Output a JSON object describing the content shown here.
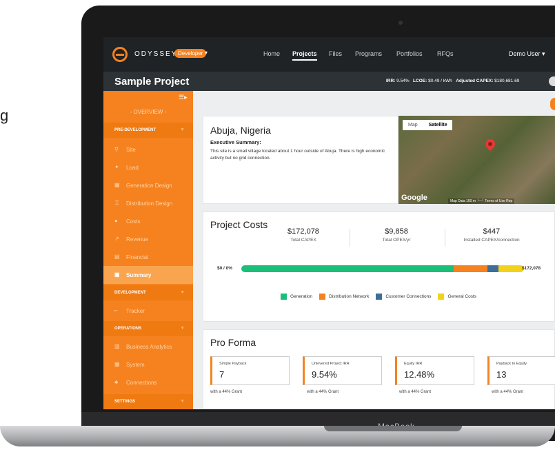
{
  "side_text": "g",
  "laptop_brand": "MacBook",
  "nav": {
    "logo_text": "ODYSSEY",
    "badge": "Developer",
    "items": [
      "Home",
      "Projects",
      "Files",
      "Programs",
      "Portfolios",
      "RFQs"
    ],
    "active": "Projects",
    "user": "Demo User ▾"
  },
  "project": {
    "title": "Sample Project",
    "irr_label": "IRR:",
    "irr": "9.54%",
    "lcoe_label": "LCOE:",
    "lcoe": "$0.49 / kWh",
    "capex_label": "Adjusted CAPEX:",
    "capex": "$180,681.69"
  },
  "sidebar": {
    "overview": "- OVERVIEW -",
    "sections": [
      {
        "label": "PRE-DEVELOPMENT",
        "items": [
          {
            "label": "Site",
            "icon": "pin-icon"
          },
          {
            "label": "Load",
            "icon": "plug-icon"
          },
          {
            "label": "Generation Design",
            "icon": "solar-panel-icon"
          },
          {
            "label": "Distribution Design",
            "icon": "tower-icon"
          },
          {
            "label": "Costs",
            "icon": "dollar-icon"
          },
          {
            "label": "Revenue",
            "icon": "chart-up-icon"
          },
          {
            "label": "Financial",
            "icon": "calculator-icon"
          },
          {
            "label": "Summary",
            "icon": "clipboard-icon"
          }
        ]
      },
      {
        "label": "DEVELOPMENT",
        "items": [
          {
            "label": "Tracker",
            "icon": "tracker-icon"
          }
        ]
      },
      {
        "label": "OPERATIONS",
        "items": [
          {
            "label": "Business Analytics",
            "icon": "bar-chart-icon"
          },
          {
            "label": "System",
            "icon": "grid-icon"
          },
          {
            "label": "Connections",
            "icon": "network-icon"
          }
        ]
      },
      {
        "label": "SETTINGS",
        "items": []
      }
    ],
    "active": "Summary"
  },
  "location": {
    "title": "Abuja, Nigeria",
    "exec_heading": "Executive Summary:",
    "exec_text": "This site is a small village located about 1 hour outside of Abuja. There is high economic activity but no grid connection."
  },
  "map": {
    "tab_map": "Map",
    "tab_satellite": "Satellite",
    "logo": "Google",
    "info": "Map Data  100 m └─┘  Terms of Use  Rep"
  },
  "costs": {
    "title": "Project Costs",
    "stats": [
      {
        "value": "$172,078",
        "label": "Total CAPEX"
      },
      {
        "value": "$9,858",
        "label": "Total OPEX/yr"
      },
      {
        "value": "$447",
        "label": "Installed CAPEX/connection"
      }
    ],
    "bar_left": "$0 / 0%",
    "bar_right": "$172,078",
    "segments": [
      {
        "name": "Generation",
        "share": 0.75,
        "color": "#1bbf7a"
      },
      {
        "name": "Distribution Network",
        "share": 0.12,
        "color": "#f5821f"
      },
      {
        "name": "Customer Connections",
        "share": 0.04,
        "color": "#3d6e9a"
      },
      {
        "name": "General Costs",
        "share": 0.09,
        "color": "#f2d21b"
      }
    ]
  },
  "proforma": {
    "title": "Pro Forma",
    "cards": [
      {
        "label": "Simple Payback",
        "value": "7",
        "sub": "with a 44% Grant"
      },
      {
        "label": "Unlevered Project IRR",
        "value": "9.54%",
        "sub": "with a 44% Grant"
      },
      {
        "label": "Equity IRR",
        "value": "12.48%",
        "sub": "with a 44% Grant"
      },
      {
        "label": "Payback to Equity",
        "value": "13",
        "sub": "with a 44% Grant"
      }
    ]
  }
}
